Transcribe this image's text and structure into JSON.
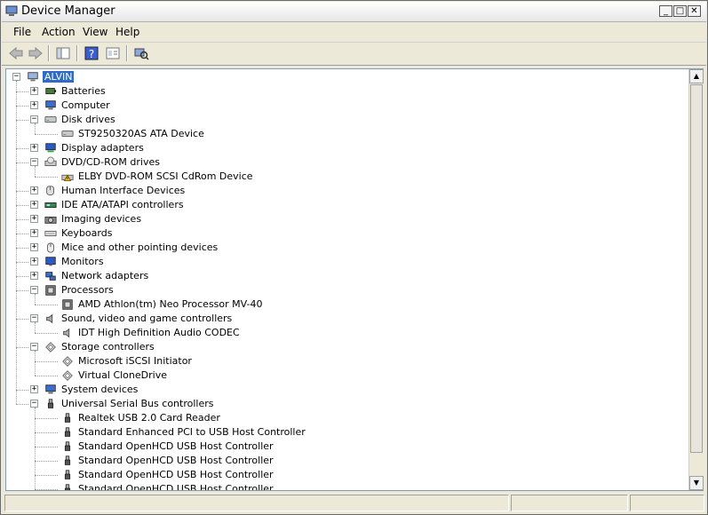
{
  "window": {
    "title": "Device Manager"
  },
  "menu": [
    "File",
    "Action",
    "View",
    "Help"
  ],
  "toolbar": {
    "buttons": [
      "back-icon",
      "forward-icon",
      "show-hide-tree-icon",
      "help-icon",
      "properties-icon",
      "scan-hardware-icon"
    ]
  },
  "tree": {
    "root": "ALVIN",
    "categories": [
      {
        "label": "Batteries",
        "icon": "battery-icon",
        "expanded": false,
        "children": []
      },
      {
        "label": "Computer",
        "icon": "computer-icon",
        "expanded": false,
        "children": []
      },
      {
        "label": "Disk drives",
        "icon": "disk-drive-icon",
        "expanded": true,
        "children": [
          {
            "label": "ST9250320AS ATA Device",
            "icon": "disk-drive-icon"
          }
        ]
      },
      {
        "label": "Display adapters",
        "icon": "display-adapter-icon",
        "expanded": false,
        "children": []
      },
      {
        "label": "DVD/CD-ROM drives",
        "icon": "dvd-drive-icon",
        "expanded": true,
        "children": [
          {
            "label": "ELBY DVD-ROM SCSI CdRom Device",
            "icon": "dvd-warning-icon"
          }
        ]
      },
      {
        "label": "Human Interface Devices",
        "icon": "hid-icon",
        "expanded": false,
        "children": []
      },
      {
        "label": "IDE ATA/ATAPI controllers",
        "icon": "ide-controller-icon",
        "expanded": false,
        "children": []
      },
      {
        "label": "Imaging devices",
        "icon": "camera-icon",
        "expanded": false,
        "children": []
      },
      {
        "label": "Keyboards",
        "icon": "keyboard-icon",
        "expanded": false,
        "children": []
      },
      {
        "label": "Mice and other pointing devices",
        "icon": "mouse-icon",
        "expanded": false,
        "children": []
      },
      {
        "label": "Monitors",
        "icon": "monitor-icon",
        "expanded": false,
        "children": []
      },
      {
        "label": "Network adapters",
        "icon": "network-adapter-icon",
        "expanded": false,
        "children": []
      },
      {
        "label": "Processors",
        "icon": "processor-icon",
        "expanded": true,
        "children": [
          {
            "label": "AMD Athlon(tm) Neo Processor MV-40",
            "icon": "processor-icon"
          }
        ]
      },
      {
        "label": "Sound, video and game controllers",
        "icon": "speaker-icon",
        "expanded": true,
        "children": [
          {
            "label": "IDT High Definition Audio CODEC",
            "icon": "speaker-icon"
          }
        ]
      },
      {
        "label": "Storage controllers",
        "icon": "storage-controller-icon",
        "expanded": true,
        "children": [
          {
            "label": "Microsoft iSCSI Initiator",
            "icon": "storage-controller-icon"
          },
          {
            "label": "Virtual CloneDrive",
            "icon": "storage-controller-icon"
          }
        ]
      },
      {
        "label": "System devices",
        "icon": "computer-icon",
        "expanded": false,
        "children": []
      },
      {
        "label": "Universal Serial Bus controllers",
        "icon": "usb-icon",
        "expanded": true,
        "children": [
          {
            "label": "Realtek USB 2.0 Card Reader",
            "icon": "usb-icon"
          },
          {
            "label": "Standard Enhanced PCI to USB Host Controller",
            "icon": "usb-icon"
          },
          {
            "label": "Standard OpenHCD USB Host Controller",
            "icon": "usb-icon"
          },
          {
            "label": "Standard OpenHCD USB Host Controller",
            "icon": "usb-icon"
          },
          {
            "label": "Standard OpenHCD USB Host Controller",
            "icon": "usb-icon"
          },
          {
            "label": "Standard OpenHCD USB Host Controller",
            "icon": "usb-icon"
          }
        ]
      }
    ]
  },
  "colors": {
    "selection": "#316ac5",
    "window_bg": "#ece9d8"
  }
}
